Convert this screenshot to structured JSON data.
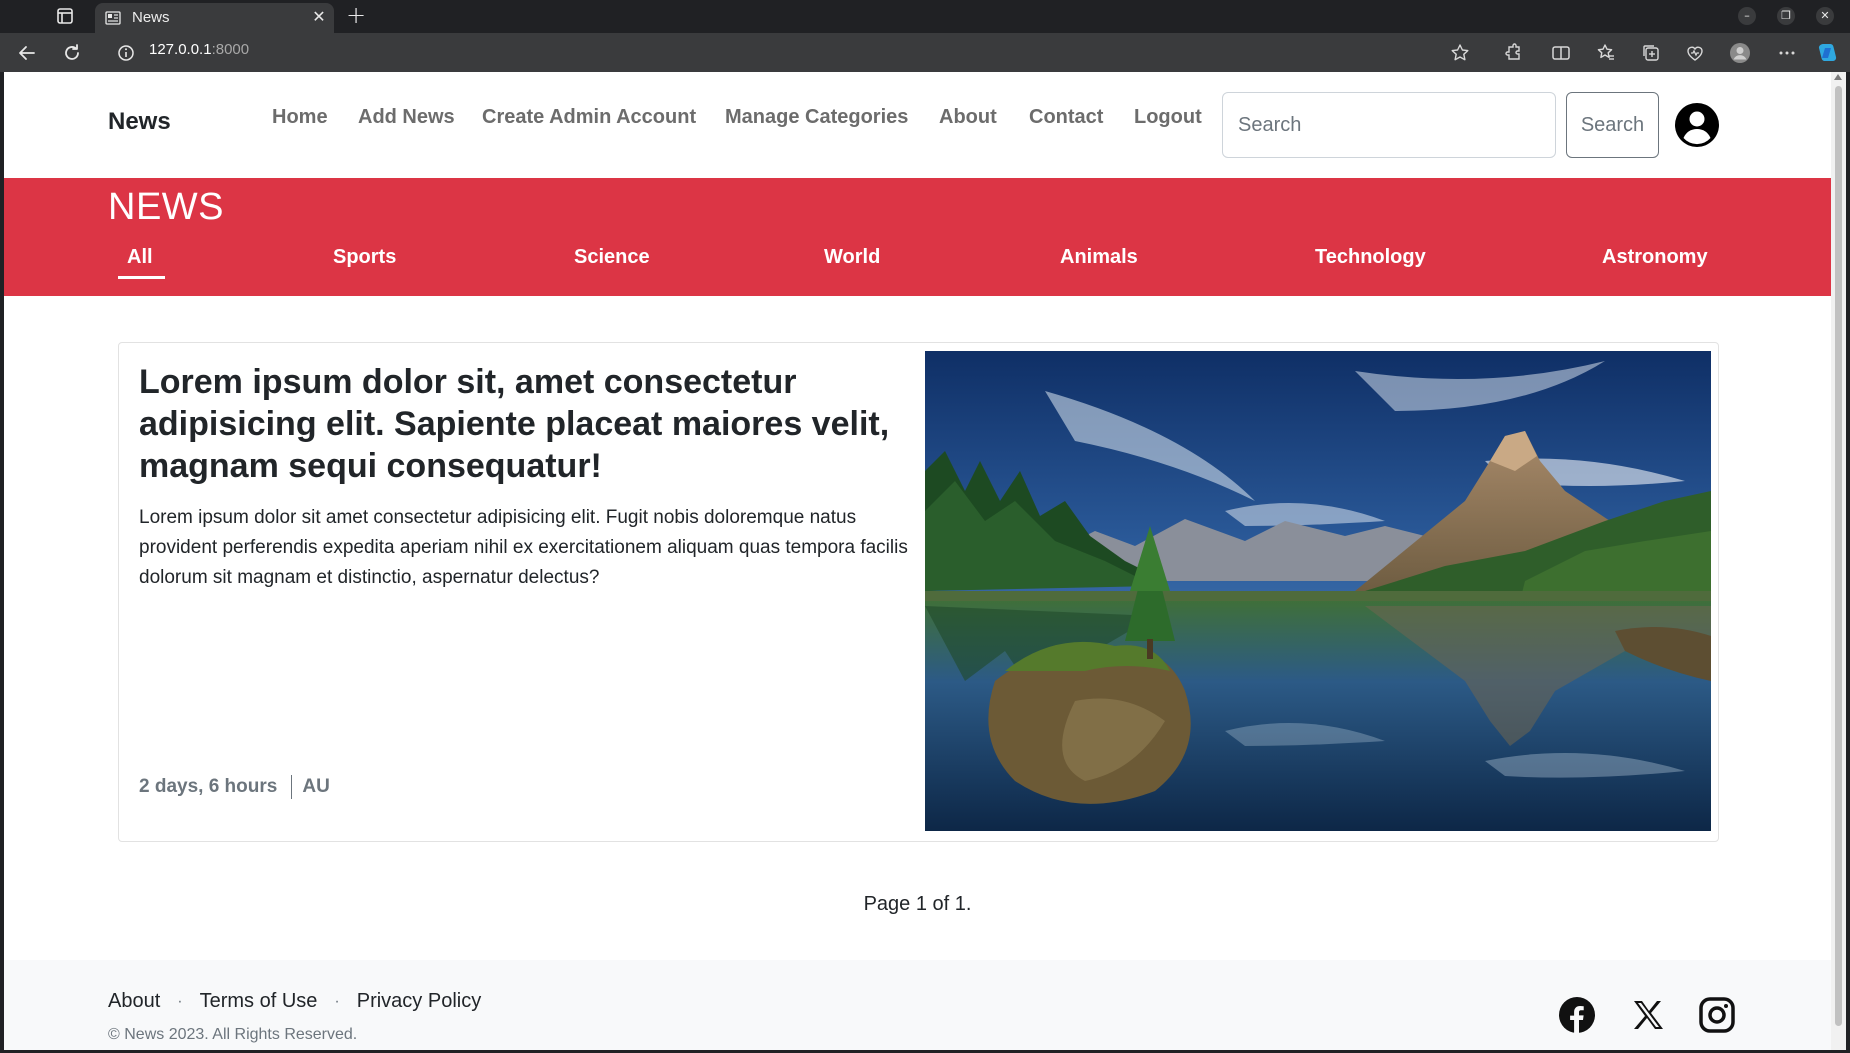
{
  "browser": {
    "tab_title": "News",
    "url_host": "127.0.0.1",
    "url_port": ":8000"
  },
  "navbar": {
    "brand": "News",
    "links": [
      "Home",
      "Add News",
      "Create Admin Account",
      "Manage Categories",
      "About",
      "Contact",
      "Logout"
    ],
    "search_placeholder": "Search",
    "search_button": "Search"
  },
  "categories": {
    "title": "NEWS",
    "items": [
      "All",
      "Sports",
      "Science",
      "World",
      "Animals",
      "Technology",
      "Astronomy"
    ],
    "active": "All"
  },
  "article": {
    "title": "Lorem ipsum dolor sit, amet consectetur adipisicing elit. Sapiente placeat maiores velit, magnam sequi consequatur!",
    "body": "Lorem ipsum dolor sit amet consectetur adipisicing elit. Fugit nobis doloremque natus provident perferendis expedita aperiam nihil ex exercitationem aliquam quas tempora facilis dolorum sit magnam et distinctio, aspernatur delectus?",
    "time": "2 days, 6 hours",
    "author": "AU",
    "image": "mountain-lake-landscape"
  },
  "pagination": "Page 1 of 1.",
  "footer": {
    "links": [
      "About",
      "Terms of Use",
      "Privacy Policy"
    ],
    "copyright": "© News 2023. All Rights Reserved.",
    "social": [
      "facebook-icon",
      "x-icon",
      "instagram-icon"
    ]
  },
  "colors": {
    "accent": "#dc3545",
    "chrome_dark": "#202124",
    "chrome_toolbar": "#3a3b3d"
  }
}
